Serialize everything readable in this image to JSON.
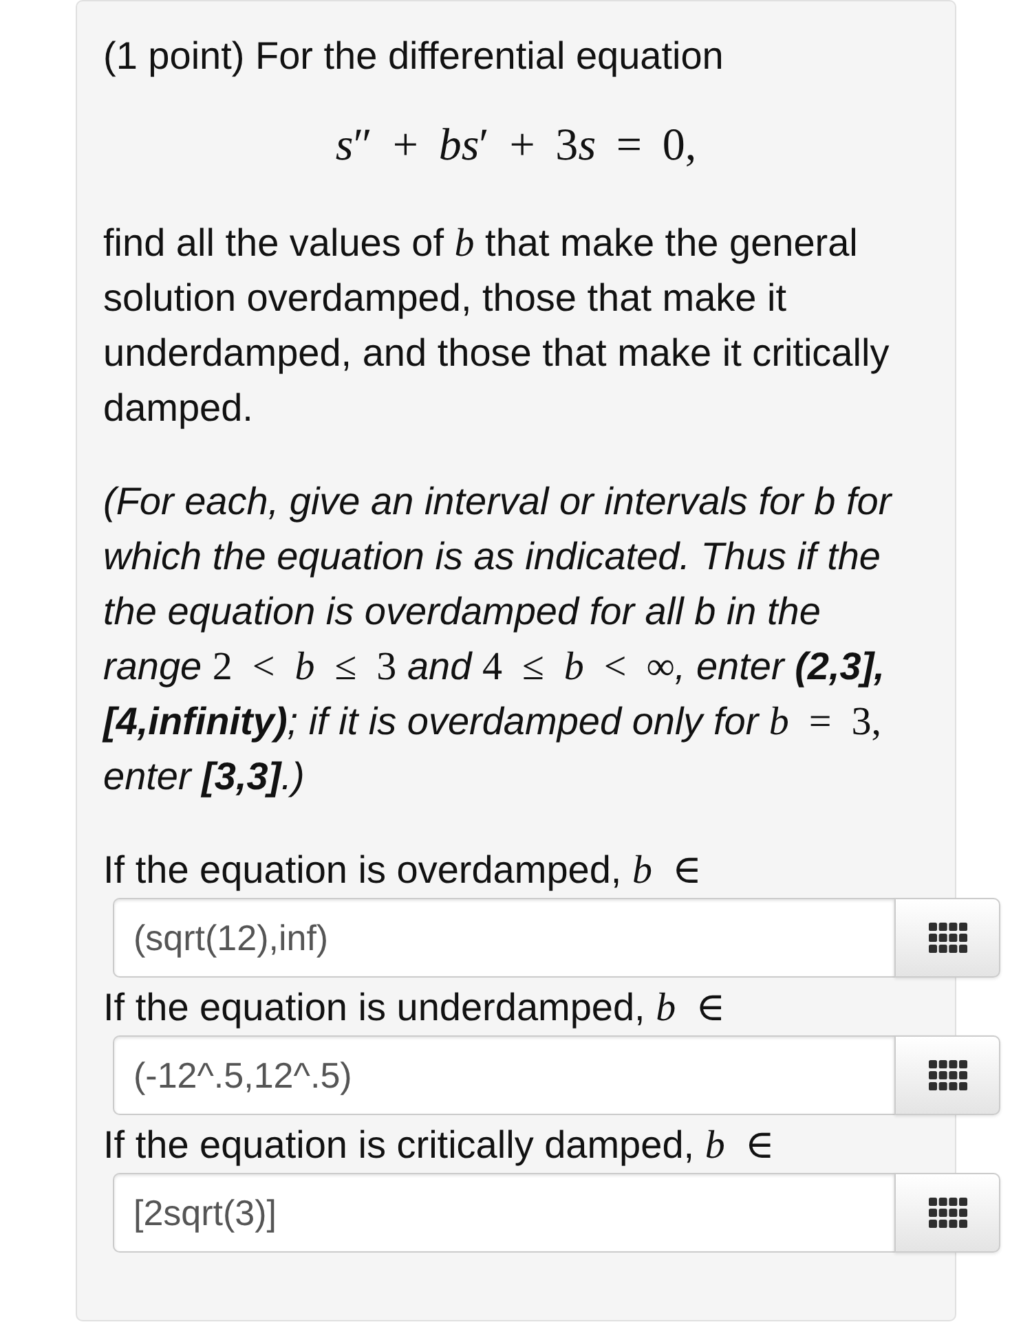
{
  "problem": {
    "header": "(1 point) For the differential equation",
    "equation": [
      {
        "kind": "var",
        "text": "s"
      },
      {
        "kind": "sym",
        "text": "″ + "
      },
      {
        "kind": "var",
        "text": "bs"
      },
      {
        "kind": "sym",
        "text": "′ + 3"
      },
      {
        "kind": "var",
        "text": "s"
      },
      {
        "kind": "sym",
        "text": " = 0,"
      }
    ],
    "paragraphs": [
      {
        "kind": "body",
        "segments": [
          {
            "kind": "text",
            "text": "find all the values of "
          },
          {
            "kind": "math",
            "text": "*b*"
          },
          {
            "kind": "text",
            "text": " that make the general solution overdamped, those that make it underdamped, and those that make it critically damped."
          }
        ]
      },
      {
        "kind": "note",
        "segments": [
          {
            "kind": "text",
            "text": "(For each, give an interval or intervals for b for which the equation is as indicated. Thus if the the equation is overdamped for all b in the range "
          },
          {
            "kind": "math",
            "text": "2 < *b* ≤ 3"
          },
          {
            "kind": "text",
            "text": " and "
          },
          {
            "kind": "math",
            "text": "4 ≤ *b* < ∞"
          },
          {
            "kind": "text",
            "text": ", enter **(2,3], [4,infinity)**; if it is overdamped only for "
          },
          {
            "kind": "math",
            "text": "*b* = 3,"
          },
          {
            "kind": "text",
            "text": " enter **[3,3]**.)"
          }
        ]
      }
    ],
    "questions": [
      {
        "label": [
          {
            "kind": "text",
            "text": "If the equation is overdamped, "
          },
          {
            "kind": "math",
            "text": "*b* ∈"
          }
        ],
        "answer": "(sqrt(12),inf)"
      },
      {
        "label": [
          {
            "kind": "text",
            "text": "If the equation is underdamped, "
          },
          {
            "kind": "math",
            "text": "*b* ∈"
          }
        ],
        "answer": "(-12^.5,12^.5)"
      },
      {
        "label": [
          {
            "kind": "text",
            "text": "If the equation is critically damped, "
          },
          {
            "kind": "math",
            "text": "*b* ∈"
          }
        ],
        "answer": "[2sqrt(3)]"
      }
    ]
  }
}
